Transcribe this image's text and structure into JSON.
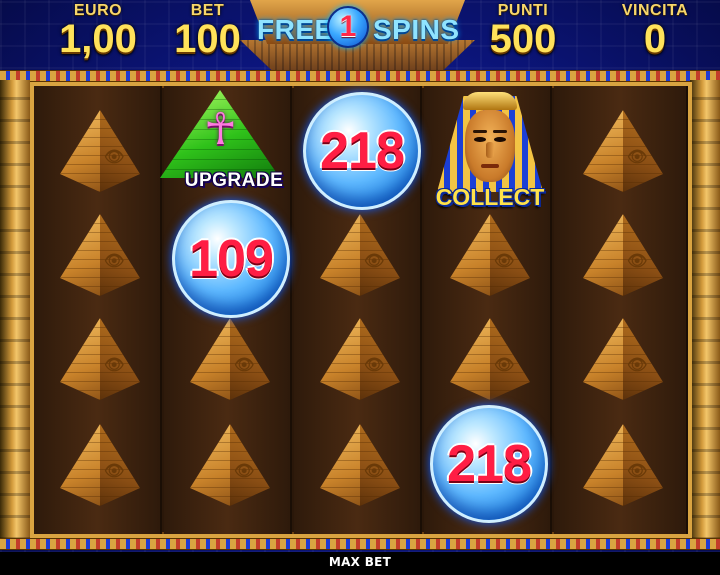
{
  "hud": {
    "euro": {
      "label": "EURO",
      "value": "1,00"
    },
    "bet": {
      "label": "BET",
      "value": "100"
    },
    "free_spins": {
      "free": "FREE",
      "count": "1",
      "spins": "SPINS"
    },
    "punti": {
      "label": "PUNTI",
      "value": "500"
    },
    "vincita": {
      "label": "VINCITA",
      "value": "0"
    }
  },
  "reels": {
    "columns": 5,
    "rows": 4,
    "special_symbols": {
      "upgrade": {
        "icon": "ankh-icon",
        "label": "UPGRADE"
      },
      "collect": {
        "icon": "pharaoh-icon",
        "label": "COLLECT"
      },
      "orbs": [
        {
          "value": "218",
          "reel": 3,
          "row": 1
        },
        {
          "value": "109",
          "reel": 2,
          "row": 2
        },
        {
          "value": "218",
          "reel": 4,
          "row": 4
        }
      ]
    },
    "filler_symbol": "pyramid-eye-icon"
  },
  "footer": {
    "max_bet_label": "MAX BET"
  },
  "colors": {
    "background": "#0c1680",
    "frame_gold": "#d9a441",
    "orb_value": "#ff1e44",
    "hud_text": "#ffe25a",
    "free_spins_text": "#8fe3ff"
  }
}
